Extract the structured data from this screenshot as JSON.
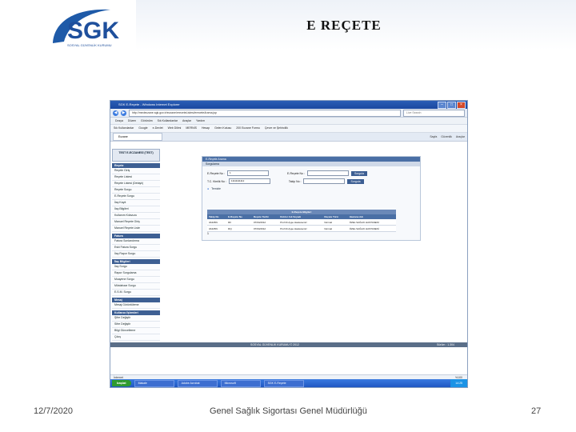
{
  "slide": {
    "title": "E REÇETE",
    "logo_text": "SGK",
    "logo_subtext": "SOSYAL GÜVENLİK KURUMU",
    "date": "12/7/2020",
    "footer_center": "Genel Sağlık Sigortası Genel Müdürlüğü",
    "page_number": "27"
  },
  "browser": {
    "window_title": "SGK E-Reçete - Windows Internet Explorer",
    "address": "http://medeczane.sgk.gov.tr/eczane/ereceteListesi/ereceteArama.jsp",
    "search_placeholder": "Live Search",
    "menu": [
      "Dosya",
      "Düzen",
      "Görünüm",
      "Sık Kullanılanlar",
      "Araçlar",
      "Yardım"
    ],
    "favorites": [
      "Sık Kullanılanlar",
      "Google",
      "e-Devlet",
      "Web Dilimi",
      "MERNİS",
      "Hesap",
      "Gelen Kutusu",
      "200 Eczane Formu",
      "Çevre ve Şehircilik"
    ],
    "tab_label": "Eczane",
    "tab_tools": [
      "Sayfa",
      "Güvenlik",
      "Araçlar"
    ],
    "status_text": "İnternet",
    "zoom": "%100"
  },
  "sidebar": {
    "header": "TEST E-ECZANESİ (TEST)",
    "sections": [
      {
        "title": "Reçete",
        "items": [
          "Reçete Giriş",
          "Reçete Listesi",
          "Reçete Listesi (Detaylı)",
          "Reçete Sorgu",
          "E-Reçete Sorgu",
          "İlaç Kayıt",
          "İlaç Bilgileri",
          "Kullanım Kılavuzu",
          "Manuel Reçete Giriş",
          "Manuel Reçete Liste"
        ]
      },
      {
        "title": "Fatura",
        "items": [
          "Fatura Sonlandırma",
          "Eski Fatura Sorgu",
          "İlaç Rapor Sorgu"
        ]
      },
      {
        "title": "İlaç Bilgileri",
        "items": [
          "İlaç Sorgu",
          "Rapor Sorgulama",
          "Muayene Sorgu",
          "Müstahzar Sorgu",
          "E.S.M. Sorgu"
        ]
      },
      {
        "title": "Mesaj",
        "items": [
          "Mesaj Görüntüleme"
        ]
      },
      {
        "title": "Kullanıcı İşlemleri",
        "items": [
          "Şifre Değiştir",
          "Sifre Değiştir",
          "Bilgi Güncelleme",
          "Çıkış"
        ]
      }
    ]
  },
  "panel": {
    "title": "E-Reçete Arama",
    "subtitle": "Sorgulama",
    "recete_no_label": "E-Reçete No :",
    "recete_no_value": "1",
    "tc_label": "T.C. Kimlik No :",
    "tc_value": "11111111112",
    "erecete_label": "E-Reçete No :",
    "erecete_value": "",
    "takip_label": "Takip No :",
    "takip_value": "",
    "search_button": "Sorgula",
    "clear_button": "Temizle",
    "results_title": "E-Reçete Bilgileri",
    "columns": [
      "Takip No",
      "E-Reçete No",
      "Reçete Tarihi",
      "Doktor Adı Soyadı",
      "Reçete Türü",
      "Hastane Adı"
    ],
    "rows": [
      [
        "3A345N",
        "RF",
        "07/04/2012",
        "Prof.Dr.Ayşe Hastanemiz",
        "Normal",
        "ÖZEL SAĞLIK HASTANESİ"
      ],
      [
        "3A345N",
        "RQ",
        "07/04/2012",
        "Prof.Dr.Ayşe Hastanemiz",
        "Normal",
        "ÖZEL SAĞLIK HASTANESİ"
      ]
    ],
    "count": "1"
  },
  "page_footer": {
    "center": "SOSYAL GÜVENLİK KURUMU © 2012",
    "right": "Sürüm : 1.304"
  },
  "taskbar": {
    "start": "başlat",
    "tasks": [
      "Makale",
      "Adobe Acrobat",
      "Microsoft",
      "SGK E-Reçete"
    ],
    "clock": "14:25"
  }
}
